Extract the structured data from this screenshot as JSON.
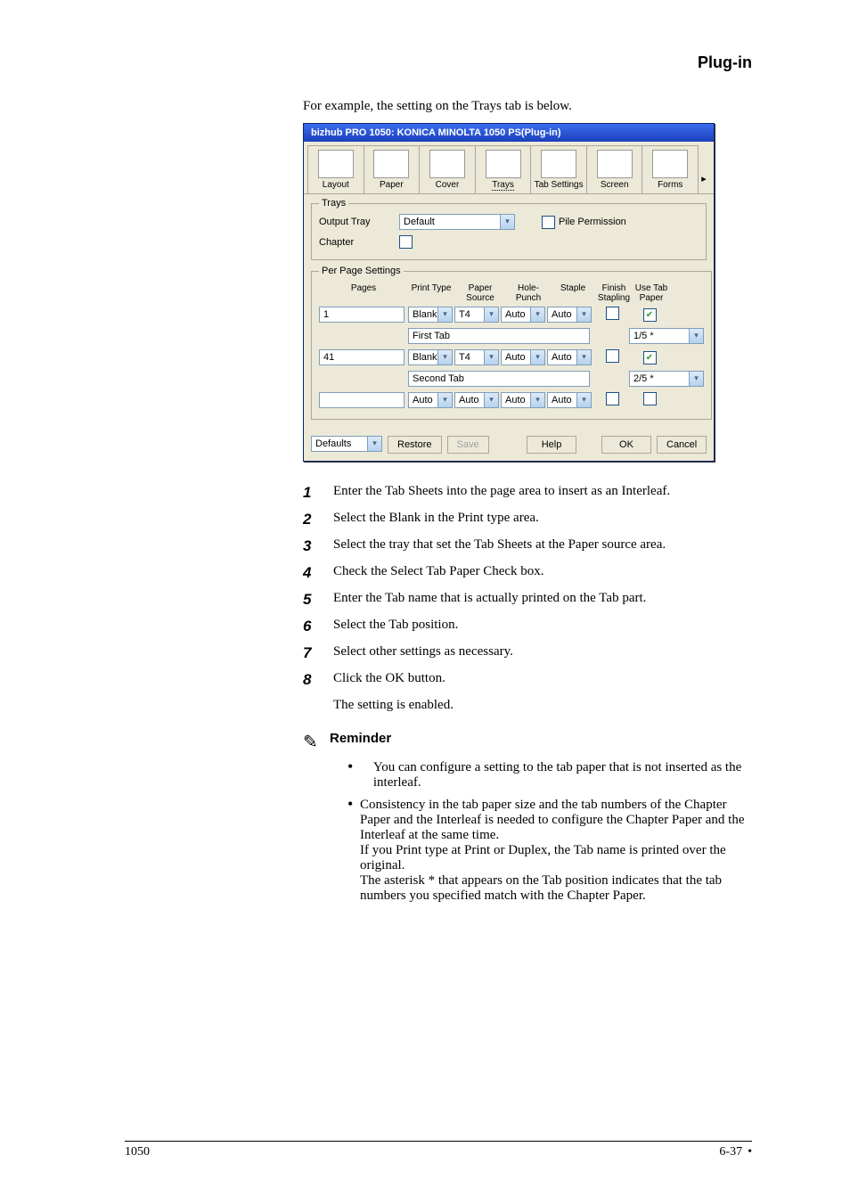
{
  "header": {
    "chapter": "Plug-in"
  },
  "dialog": {
    "title": "bizhub PRO 1050: KONICA MINOLTA 1050 PS(Plug-in)",
    "tabs": {
      "layout": "Layout",
      "paper": "Paper",
      "cover": "Cover",
      "trays": "Trays",
      "tab_settings": "Tab Settings",
      "screen": "Screen",
      "forms": "Forms"
    },
    "trays_group": {
      "legend": "Trays",
      "output_tray_label": "Output Tray",
      "output_tray_value": "Default",
      "pile_label": "Pile Permission",
      "chapter_label": "Chapter"
    },
    "pps": {
      "legend": "Per Page Settings",
      "cols": {
        "pages": "Pages",
        "print_type": "Print Type",
        "paper_source": "Paper Source",
        "hole_punch": "Hole-Punch",
        "staple": "Staple",
        "finish_stapling": "Finish\nStapling",
        "use_tab_paper": "Use Tab\nPaper"
      },
      "rows": [
        {
          "pages": "1",
          "print_type": "Blank",
          "paper_source": "T4",
          "hole_punch": "Auto",
          "staple": "Auto",
          "finish": false,
          "use_tab": true
        },
        {
          "tab_name": "First Tab",
          "pos": "1/5 *"
        },
        {
          "pages": "41",
          "print_type": "Blank",
          "paper_source": "T4",
          "hole_punch": "Auto",
          "staple": "Auto",
          "finish": false,
          "use_tab": true
        },
        {
          "tab_name": "Second Tab",
          "pos": "2/5 *"
        },
        {
          "pages": "",
          "print_type": "Auto",
          "paper_source": "Auto",
          "hole_punch": "Auto",
          "staple": "Auto",
          "finish": false,
          "use_tab": false
        }
      ]
    },
    "buttons": {
      "defaults": "Defaults",
      "restore": "Restore",
      "save": "Save",
      "help": "Help",
      "ok": "OK",
      "cancel": "Cancel"
    }
  },
  "text": {
    "intro": "For example, the setting on the Trays tab is below.",
    "s1": "Enter the Tab Sheets into the page area to insert as an Interleaf.",
    "s2": "Select the Blank in the Print type area.",
    "s3": "Select the tray that set the Tab Sheets at the Paper source area.",
    "s4": "Check the Select Tab Paper Check box.",
    "s5": "Enter the Tab name that is actually printed on the Tab part.",
    "s6": "Select the Tab position.",
    "s7": "Select other settings as necessary.",
    "s8": "Click the OK button.",
    "closing": "The setting is enabled.",
    "reminder": "Reminder",
    "b1": "You can configure a setting to the tab paper that is not inserted as the interleaf.",
    "b2_a": "Consistency in the tab paper size and the tab numbers of the Chapter Paper and the Interleaf is needed to configure the Chapter Paper and the Interleaf at the same time.",
    "b2_b": "If you Print type at Print or Duplex, the Tab name is printed over the original.",
    "b2_c": "The asterisk * that appears on the Tab position indicates that the tab numbers you specified match with the Chapter Paper."
  },
  "footer": {
    "model": "1050",
    "page": "6-37"
  }
}
